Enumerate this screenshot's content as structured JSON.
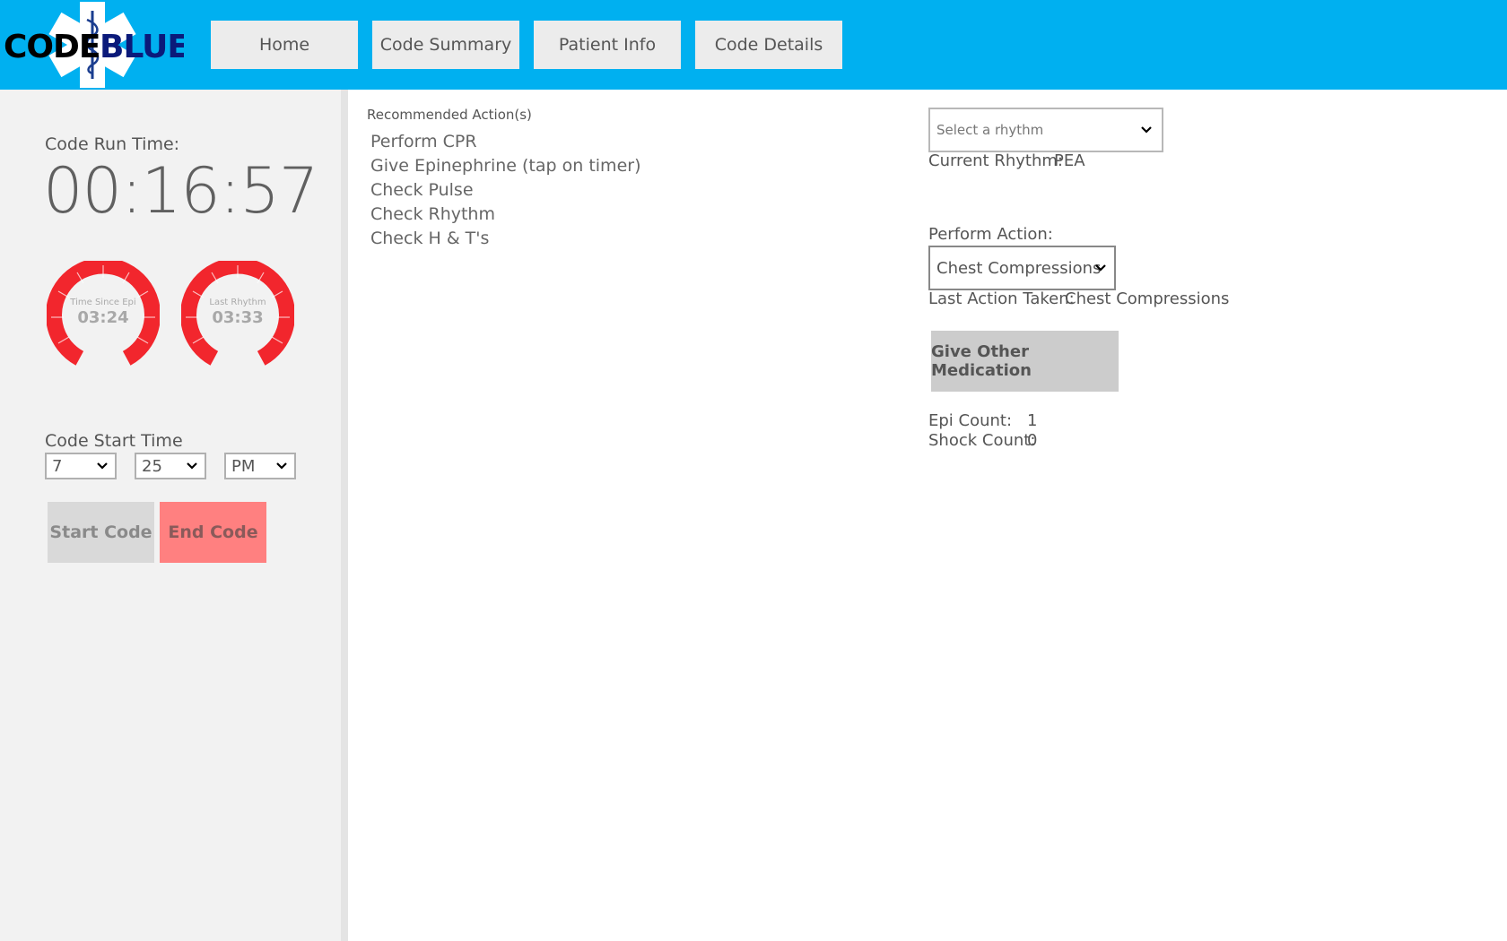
{
  "header": {
    "logo": {
      "text_left": "CODE",
      "text_right": "BLUE",
      "icon": "star-of-life-icon"
    },
    "nav": [
      {
        "label": "Home"
      },
      {
        "label": "Code Summary"
      },
      {
        "label": "Patient Info"
      },
      {
        "label": "Code Details"
      }
    ]
  },
  "sidebar": {
    "run_time_label": "Code Run Time:",
    "run_time": "00:16:57",
    "gauges": [
      {
        "label": "Time Since Epi",
        "value": "03:24"
      },
      {
        "label": "Last Rhythm",
        "value": "03:33"
      }
    ],
    "start_time_label": "Code Start Time",
    "start_hour": "7",
    "start_minute": "25",
    "start_ampm": "PM",
    "start_button": "Start Code",
    "end_button": "End Code"
  },
  "main": {
    "recommended_title": "Recommended Action(s)",
    "recommended": [
      "Perform CPR",
      "Give Epinephrine (tap on timer)",
      "Check Pulse",
      "Check Rhythm",
      "Check H & T's"
    ],
    "rhythm_placeholder": "Select a rhythm",
    "current_rhythm_label": "Current Rhythm:",
    "current_rhythm_value": "PEA",
    "perform_action_label": "Perform Action:",
    "perform_action_selected": "Chest Compressions",
    "last_action_label": "Last Action Taken:",
    "last_action_value": "Chest Compressions",
    "give_med_button": "Give Other Medication",
    "epi_count_label": "Epi Count:",
    "epi_count_value": "1",
    "shock_count_label": "Shock Count:",
    "shock_count_value": "0"
  },
  "colors": {
    "header": "#00b0f0",
    "gauge": "#f2262d",
    "end_button": "#ff8080",
    "logo_blue": "#1a3d8f"
  }
}
